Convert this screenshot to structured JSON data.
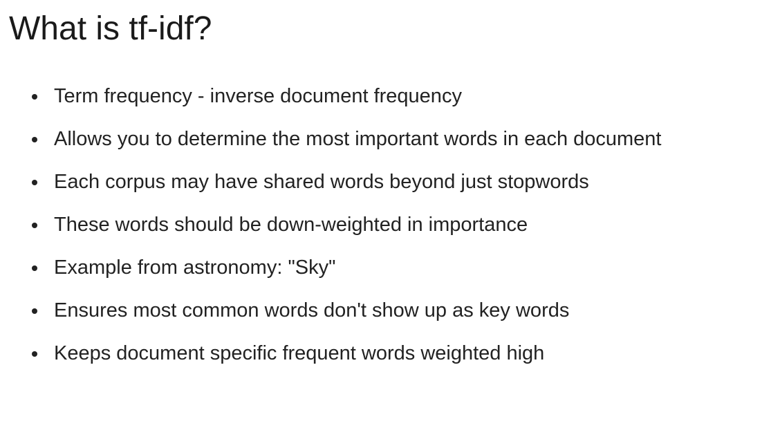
{
  "slide": {
    "title": "What is tf-idf?",
    "bullets": [
      "Term frequency - inverse document frequency",
      "Allows you to determine the most important words in each document",
      "Each corpus may have shared words beyond just stopwords",
      "These words should be down-weighted in importance",
      "Example from astronomy: \"Sky\"",
      "Ensures most common words don't show up as key words",
      "Keeps document specific frequent words weighted high"
    ]
  }
}
